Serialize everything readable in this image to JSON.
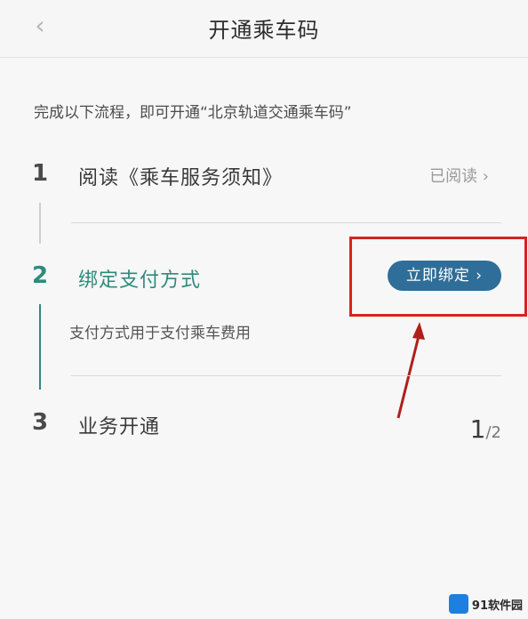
{
  "header": {
    "title": "开通乘车码"
  },
  "intro": "完成以下流程，即可开通“北京轨道交通乘车码”",
  "steps": [
    {
      "number": "1",
      "title": "阅读《乘车服务须知》",
      "status": "已阅读 ›"
    },
    {
      "number": "2",
      "title": "绑定支付方式",
      "button": "立即绑定 ›",
      "description": "支付方式用于支付乘车费用"
    },
    {
      "number": "3",
      "title": "业务开通"
    }
  ],
  "progress": {
    "current": "1",
    "separator": "/2"
  },
  "watermark": {
    "text": "91软件园"
  },
  "colors": {
    "accent": "#2f8a7c",
    "button": "#2f6e98",
    "annotation": "#d8231f"
  }
}
